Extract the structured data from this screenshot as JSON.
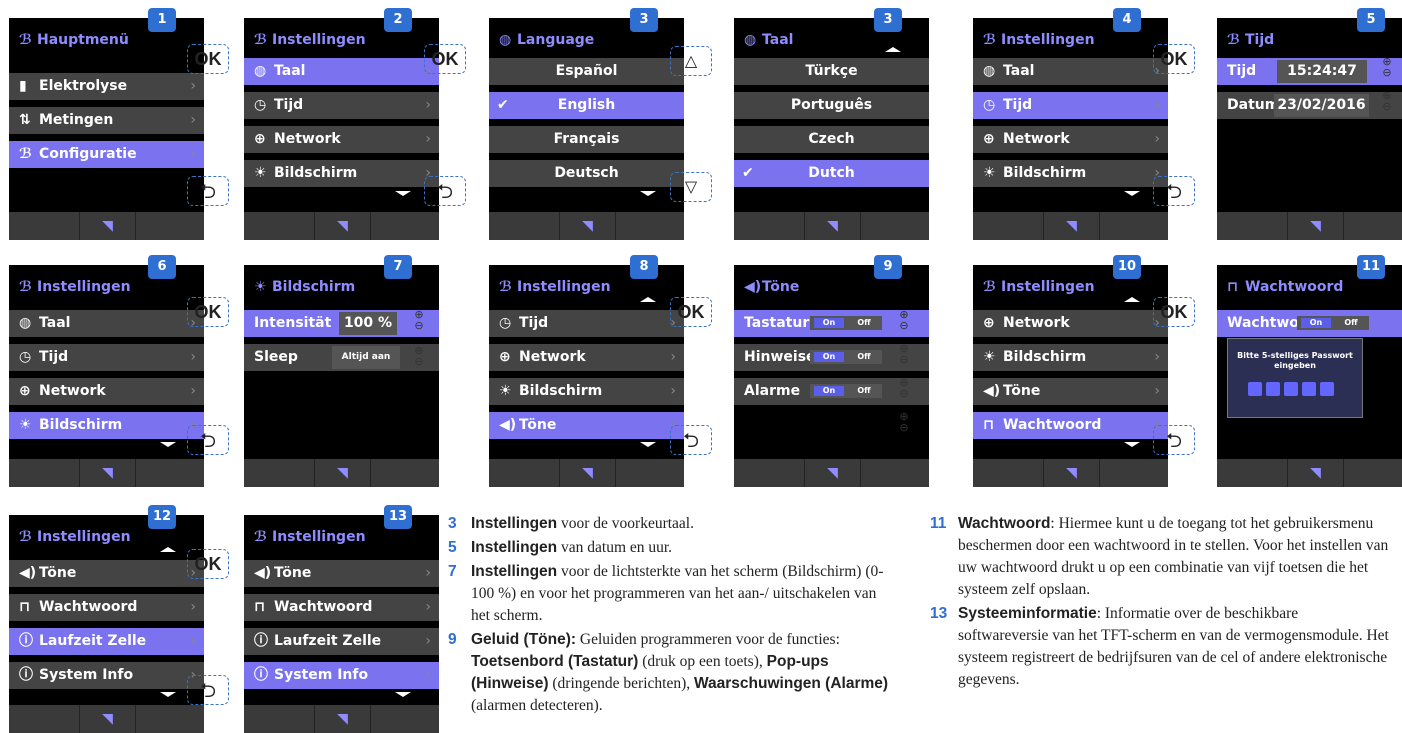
{
  "ok_label": "OK",
  "back_glyph": "⮌",
  "rss_glyph": "◥",
  "plus_minus": "⊕⊖",
  "screens": {
    "s1": {
      "badge": "1",
      "title": "Hauptmenü",
      "items": [
        "Elektrolyse",
        "Metingen",
        "Configuratie"
      ]
    },
    "s2": {
      "badge": "2",
      "title": "Instellingen",
      "items": [
        "Taal",
        "Tijd",
        "Network",
        "Bildschirm"
      ]
    },
    "s3": {
      "badge": "3",
      "title": "Language",
      "items": [
        "Español",
        "English",
        "Français",
        "Deutsch"
      ]
    },
    "s3b": {
      "badge": "3",
      "title": "Taal",
      "items": [
        "Türkçe",
        "Português",
        "Czech",
        "Dutch"
      ]
    },
    "s4": {
      "badge": "4",
      "title": "Instellingen",
      "items": [
        "Taal",
        "Tijd",
        "Network",
        "Bildschirm"
      ]
    },
    "s5": {
      "badge": "5",
      "title": "Tijd",
      "tijd_label": "Tijd",
      "tijd_value": "15:24:47",
      "datum_label": "Datum",
      "datum_value": "23/02/2016"
    },
    "s6": {
      "badge": "6",
      "title": "Instellingen",
      "items": [
        "Taal",
        "Tijd",
        "Network",
        "Bildschirm"
      ]
    },
    "s7": {
      "badge": "7",
      "title": "Bildschirm",
      "intensity_label": "Intensität",
      "intensity_value": "100 %",
      "sleep_label": "Sleep",
      "sleep_value": "Altijd aan"
    },
    "s8": {
      "badge": "8",
      "title": "Instellingen",
      "items": [
        "Tijd",
        "Network",
        "Bildschirm",
        "Töne"
      ]
    },
    "s9": {
      "badge": "9",
      "title": "Töne",
      "rows": [
        "Tastatur",
        "Hinweise",
        "Alarme"
      ],
      "on": "On",
      "off": "Off"
    },
    "s10": {
      "badge": "10",
      "title": "Instellingen",
      "items": [
        "Network",
        "Bildschirm",
        "Töne",
        "Wachtwoord"
      ]
    },
    "s11": {
      "badge": "11",
      "title": "Wachtwoord",
      "row_label": "Wachtwoor",
      "on": "On",
      "off": "Off",
      "dialog": "Bitte 5-stelliges Passwort eingeben"
    },
    "s12": {
      "badge": "12",
      "title": "Instellingen",
      "items": [
        "Töne",
        "Wachtwoord",
        "Laufzeit Zelle",
        "System Info"
      ]
    },
    "s13": {
      "badge": "13",
      "title": "Instellingen",
      "items": [
        "Töne",
        "Wachtwoord",
        "Laufzeit Zelle",
        "System Info"
      ]
    }
  },
  "notes_left": [
    {
      "num": "3",
      "bold": "Instellingen",
      "text": " voor de voorkeurtaal."
    },
    {
      "num": "5",
      "bold": "Instellingen",
      "text": " van datum en uur."
    },
    {
      "num": "7",
      "bold": "Instellingen",
      "text": " voor de lichtsterkte van het scherm (Bildschirm) (0-100 %) en voor het programmeren van het aan-/ uitschakelen van het scherm."
    },
    {
      "num": "9",
      "bold": "Geluid (Töne):",
      "text": " Geluiden programmeren voor de functies: ",
      "bold2": "Toetsenbord (Tastatur)",
      "text2": " (druk op een toets), ",
      "bold3": "Pop-ups (Hinweise)",
      "text3": " (dringende berichten), ",
      "bold4": "Waarschuwingen (Alarme)",
      "text4": " (alarmen detecteren)."
    }
  ],
  "notes_right": [
    {
      "num": "11",
      "bold": "Wachtwoord",
      "text": ": Hiermee kunt u de toegang tot het gebruikersmenu beschermen door een wachtwoord in te stellen. Voor het instellen van uw wachtwoord drukt u op een combinatie van vijf toetsen die het systeem zelf opslaan."
    },
    {
      "num": "13",
      "bold": "Systeeminformatie",
      "text": ": Informatie over de beschikbare softwareversie van het TFT-scherm en van de vermogensmodule. Het systeem registreert de bedrijfsuren van de cel of andere elektronische gegevens."
    }
  ]
}
